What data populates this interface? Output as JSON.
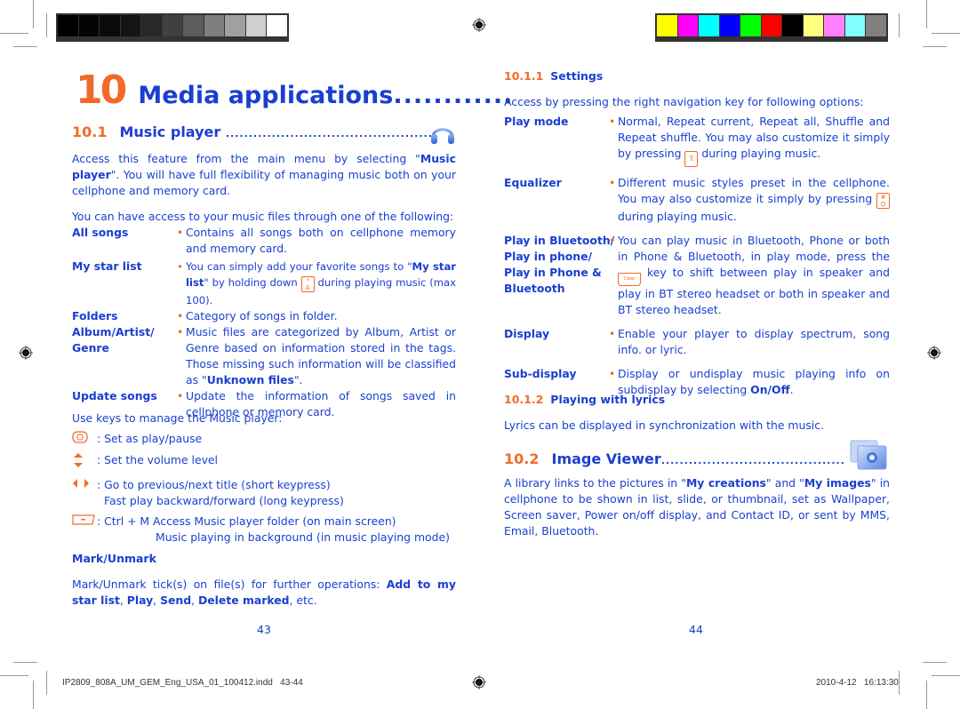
{
  "print_marks": {
    "grayscale_swatches": [
      "#000000",
      "#040404",
      "#0a0a0a",
      "#141414",
      "#282828",
      "#404040",
      "#5c5c5c",
      "#7e7e7e",
      "#a0a0a0",
      "#cfcfcf",
      "#ffffff"
    ],
    "color_swatches": [
      "#ffff00",
      "#ff00ff",
      "#00ffff",
      "#0000ff",
      "#00ff00",
      "#ff0000",
      "#000000",
      "#ffff80",
      "#ff80ff",
      "#80ffff",
      "#808080"
    ],
    "slug_file": "IP2809_808A_UM_GEM_Eng_USA_01_100412.indd   43-44",
    "slug_timestamp": "2010-4-12   16:13:30"
  },
  "left_page": {
    "chapter_number": "10",
    "chapter_title": "Media applications",
    "chapter_dots": "............",
    "section": {
      "number": "10.1",
      "title": "Music player",
      "dots": "..............................................",
      "icon": "headphones-icon"
    },
    "intro": {
      "pre": "Access this feature from the main menu by selecting \"",
      "bold": "Music player",
      "post": "\". You will have full flexibility of managing music both on your cellphone and memory card."
    },
    "access_intro": "You can have access to your music files through one of the following:",
    "options": [
      {
        "term": "All songs",
        "desc": "Contains all songs both on cellphone memory and memory card."
      },
      {
        "term": "My star list",
        "desc_pre": "You can simply add your favorite songs to \"",
        "desc_bold": "My star list",
        "desc_mid": "\" by holding down ",
        "key_top": "*",
        "key_bottom": "A",
        "desc_post": " during playing music (max 100)."
      },
      {
        "term": "Folders",
        "desc": "Category of songs in folder."
      },
      {
        "term": "Album/Artist/ Genre",
        "desc_pre": "Music files are categorized by Album, Artist or Genre based on information stored in the tags. Those missing such information will be classified as \"",
        "desc_bold": "Unknown files",
        "desc_post": "\"."
      },
      {
        "term": "Update songs",
        "desc": "Update the information of songs saved in cellphone or memory card."
      }
    ],
    "keys_intro": "Use keys to manage the Music player:",
    "keys": [
      {
        "icon": "ok-key-icon",
        "text": ": Set as play/pause"
      },
      {
        "icon": "up-down-key-icon",
        "text": ": Set the volume level"
      },
      {
        "icon": "left-right-key-icon",
        "text": ": Go to previous/next title (short keypress)",
        "text2": "Fast play backward/forward (long keypress)"
      },
      {
        "icon": "music-key-icon",
        "text": ": Ctrl + M Access Music player folder (on main screen)",
        "text2": "Music playing in background (in music playing mode)"
      }
    ],
    "mark_heading": "Mark/Unmark",
    "mark_text": {
      "pre": "Mark/Unmark tick(s) on file(s) for further operations: ",
      "b1": "Add to my star list",
      "s1": ", ",
      "b2": "Play",
      "s2": ", ",
      "b3": "Send",
      "s3": ", ",
      "b4": "Delete marked",
      "post": ", etc."
    },
    "page_number": "43"
  },
  "right_page": {
    "settings": {
      "number": "10.1.1",
      "title": "Settings"
    },
    "settings_intro": "Access by pressing the right navigation key for following options:",
    "settings_options": [
      {
        "term": "Play mode",
        "desc_pre": "Normal, Repeat current, Repeat all, Shuffle and Repeat shuffle. You may also customize it simply by pressing ",
        "key_top": "⇧",
        "key_bottom": "",
        "desc_post": " during playing music."
      },
      {
        "term": "Equalizer",
        "desc_pre": "Different music styles preset in the cellphone. You may also customize it simply by pressing ",
        "key_top": "#",
        "key_bottom": "Q",
        "desc_post": " during playing music."
      },
      {
        "term": "Play in Bluetooth/ Play in phone/ Play in Phone & Bluetooth",
        "desc_pre": "You can play music in Bluetooth, Phone or both in Phone & Bluetooth, in play mode, press the ",
        "key_top": "Clear",
        "key_bottom": "",
        "desc_post": " key to shift between play in speaker and play in BT stereo headset or both in speaker and BT stereo headset."
      },
      {
        "term": "Display",
        "desc": "Enable your player to display spectrum, song info. or lyric."
      },
      {
        "term": "Sub-display",
        "desc_pre": "Display or undisplay music playing info on subdisplay by selecting ",
        "desc_bold": "On/Off",
        "desc_post": "."
      }
    ],
    "lyrics": {
      "number": "10.1.2",
      "title": "Playing with lyrics"
    },
    "lyrics_text": "Lyrics can be displayed in synchronization with the music.",
    "image_viewer": {
      "number": "10.2",
      "title": "Image Viewer",
      "dots": "..........................................",
      "icon": "image-viewer-icon"
    },
    "image_text": {
      "pre": "A library links to the pictures in \"",
      "b1": "My creations",
      "mid": "\" and \"",
      "b2": "My images",
      "post": "\" in cellphone to be shown in list, slide, or thumbnail, set as Wallpaper, Screen saver, Power on/off display, and Contact ID, or sent by MMS, Email, Bluetooth."
    },
    "page_number": "44"
  },
  "colors": {
    "text_blue": "#1a3fd0",
    "accent_orange": "#f26a2a"
  }
}
